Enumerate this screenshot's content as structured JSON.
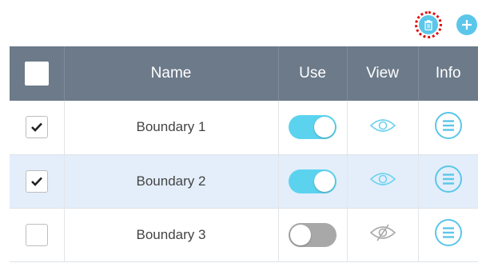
{
  "table": {
    "headers": {
      "name": "Name",
      "use": "Use",
      "view": "View",
      "info": "Info"
    },
    "rows": [
      {
        "name": "Boundary 1",
        "checked": true,
        "use": true,
        "visible": true,
        "selected": false
      },
      {
        "name": "Boundary 2",
        "checked": true,
        "use": true,
        "visible": true,
        "selected": true
      },
      {
        "name": "Boundary 3",
        "checked": false,
        "use": false,
        "visible": false,
        "selected": false
      }
    ]
  },
  "icons": {
    "delete": "trash-icon",
    "add": "plus-icon",
    "view_on": "eye-icon",
    "view_off": "eye-off-icon",
    "info": "list-icon",
    "check": "check-icon"
  },
  "colors": {
    "accent": "#5bc6ea",
    "header_bg": "#6c7a8a",
    "selected_row": "#e3eefa",
    "toggle_on": "#5bd3ef",
    "toggle_off": "#a8a8a8",
    "highlight_ring": "#e01010"
  }
}
